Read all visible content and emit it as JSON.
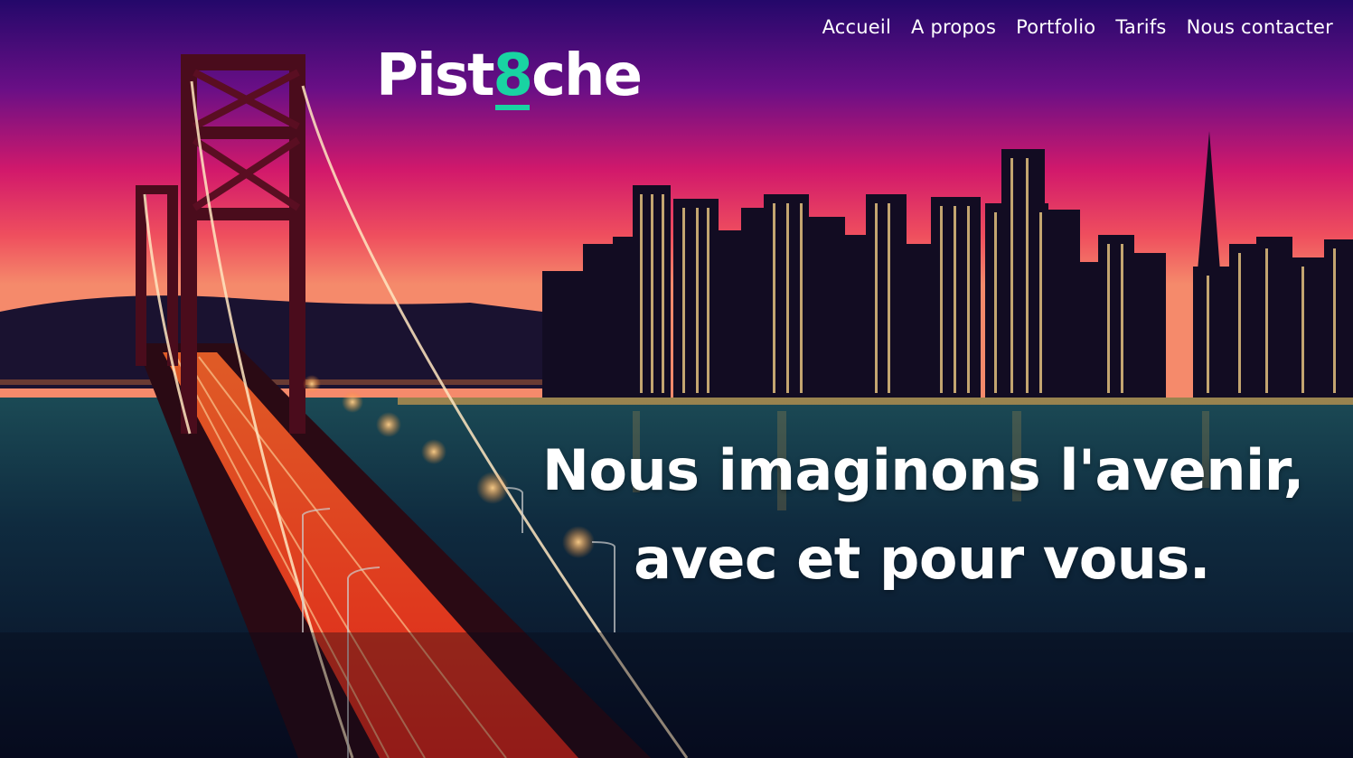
{
  "colors": {
    "accent": "#19d3a2",
    "text": "#ffffff",
    "sky_top": "#2a0c6e",
    "sky_mid": "#c2186b",
    "sky_horizon": "#f06a5a",
    "water": "#0d2a3a"
  },
  "nav": {
    "items": [
      {
        "label": "Accueil"
      },
      {
        "label": "A propos"
      },
      {
        "label": "Portfolio"
      },
      {
        "label": "Tarifs"
      },
      {
        "label": "Nous contacter"
      }
    ]
  },
  "logo": {
    "prefix": "Pist",
    "accent": "8",
    "suffix": "che"
  },
  "hero": {
    "line1": "Nous imaginons l'avenir,",
    "line2": "avec et pour vous."
  }
}
